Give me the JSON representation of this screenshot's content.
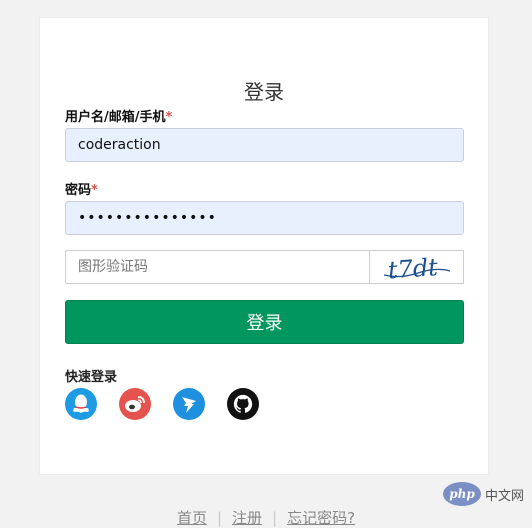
{
  "form": {
    "title": "登录",
    "username_label": "用户名/邮箱/手机",
    "username_required": "*",
    "username_value": "coderaction",
    "password_label": "密码",
    "password_required": "*",
    "password_value": "•••••••••••••••",
    "captcha_placeholder": "图形验证码",
    "captcha_image_text": "t7dt",
    "submit_label": "登录"
  },
  "quick_login": {
    "label": "快速登录",
    "providers": [
      {
        "name": "qq-icon"
      },
      {
        "name": "weibo-icon"
      },
      {
        "name": "dingtalk-icon"
      },
      {
        "name": "github-icon"
      }
    ]
  },
  "footer": {
    "home": "首页",
    "register": "注册",
    "forgot": "忘记密码?"
  },
  "watermark": {
    "badge": "php",
    "text": "中文网"
  },
  "colors": {
    "submit_bg": "#00965e",
    "page_bg": "#f2f2f2",
    "input_autofill_bg": "#e8f0fe",
    "required_star": "#d9534f"
  }
}
